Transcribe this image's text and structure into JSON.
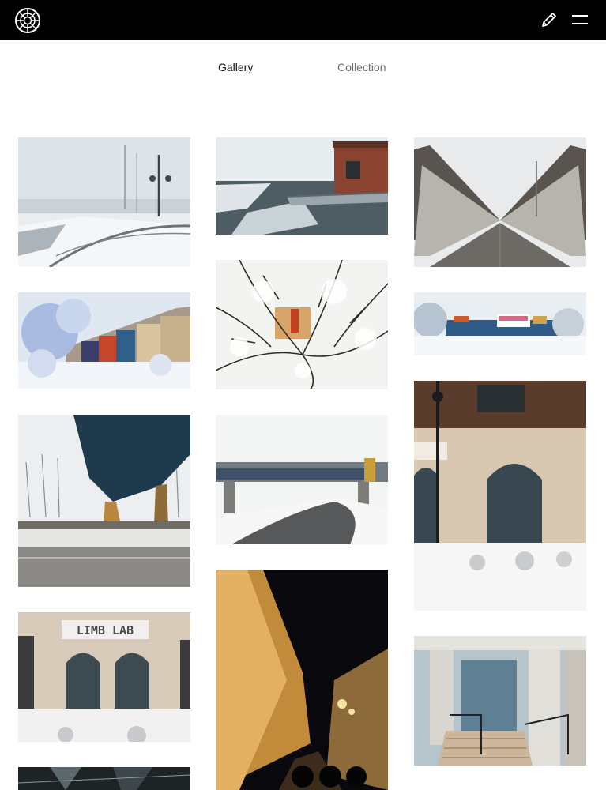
{
  "header": {
    "logo_icon": "vsco-logo-icon",
    "edit_icon": "pencil-icon",
    "menu_icon": "hamburger-menu-icon",
    "background": "#000000"
  },
  "tabs": {
    "gallery_label": "Gallery",
    "collection_label": "Collection",
    "active": "Gallery"
  },
  "gallery": {
    "photos": [
      {
        "subject": "foggy waterfront boardwalk with lamp posts and snow"
      },
      {
        "subject": "icy river with brick building and pier"
      },
      {
        "subject": "arched footbridge fading into fog"
      },
      {
        "subject": "snowy trees in front of colorful apartment buildings"
      },
      {
        "subject": "snow-covered branches close-up"
      },
      {
        "subject": "colorful buildings behind a snowy bridge"
      },
      {
        "subject": "underside of a bridge over a snowy road"
      },
      {
        "subject": "railroad bridge over a snowy curving road"
      },
      {
        "subject": "building facade with arched windows, lamp post and snow"
      },
      {
        "subject": "LIMB LAB storefront in the snow",
        "sign_text": "LIMB LAB"
      },
      {
        "subject": "night street with lit buildings and silhouettes"
      },
      {
        "subject": "stone columns and stairs in a lobby"
      },
      {
        "subject": "dark geometric structure from below"
      }
    ]
  }
}
